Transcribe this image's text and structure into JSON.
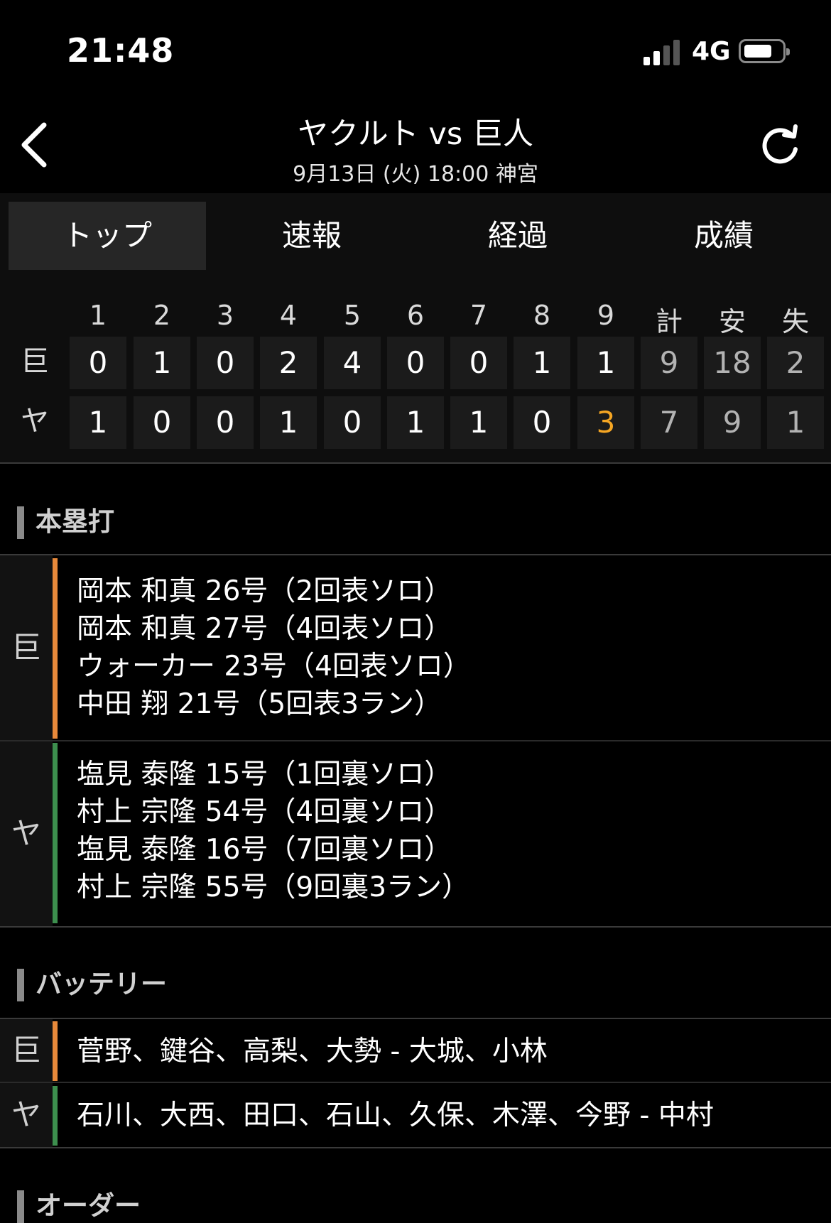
{
  "status_bar": {
    "time": "21:48",
    "network": "4G"
  },
  "header": {
    "title": "ヤクルト vs 巨人",
    "subtitle": "9月13日 (火) 18:00 神宮",
    "back_icon": "chevron-left-icon",
    "reload_icon": "reload-icon"
  },
  "tabs": [
    {
      "label": "トップ",
      "active": true
    },
    {
      "label": "速報",
      "active": false
    },
    {
      "label": "経過",
      "active": false
    },
    {
      "label": "成績",
      "active": false
    }
  ],
  "scoreboard": {
    "headers": [
      "1",
      "2",
      "3",
      "4",
      "5",
      "6",
      "7",
      "8",
      "9",
      "計",
      "安",
      "失"
    ],
    "rows": [
      {
        "team": "巨",
        "innings": [
          "0",
          "1",
          "0",
          "2",
          "4",
          "0",
          "0",
          "1",
          "1"
        ],
        "runs": "9",
        "hits": "18",
        "errors": "2"
      },
      {
        "team": "ヤ",
        "innings": [
          "1",
          "0",
          "0",
          "1",
          "0",
          "1",
          "1",
          "0",
          "3"
        ],
        "runs": "7",
        "hits": "9",
        "errors": "1"
      }
    ],
    "highlight_color": "#f5a623"
  },
  "home_runs": {
    "title": "本塁打",
    "teams": [
      {
        "team": "巨",
        "color": "#e8893a",
        "lines": [
          "岡本 和真 26号（2回表ソロ）",
          "岡本 和真 27号（4回表ソロ）",
          "ウォーカー 23号（4回表ソロ）",
          "中田 翔 21号（5回表3ラン）"
        ]
      },
      {
        "team": "ヤ",
        "color": "#3d8f4e",
        "lines": [
          "塩見 泰隆 15号（1回裏ソロ）",
          "村上 宗隆 54号（4回裏ソロ）",
          "塩見 泰隆 16号（7回裏ソロ）",
          "村上 宗隆 55号（9回裏3ラン）"
        ]
      }
    ]
  },
  "battery": {
    "title": "バッテリー",
    "teams": [
      {
        "team": "巨",
        "color": "#e8893a",
        "text": "菅野、鍵谷、高梨、大勢 - 大城、小林"
      },
      {
        "team": "ヤ",
        "color": "#3d8f4e",
        "text": "石川、大西、田口、石山、久保、木澤、今野 - 中村"
      }
    ]
  },
  "next_section": {
    "title": "オーダー"
  }
}
